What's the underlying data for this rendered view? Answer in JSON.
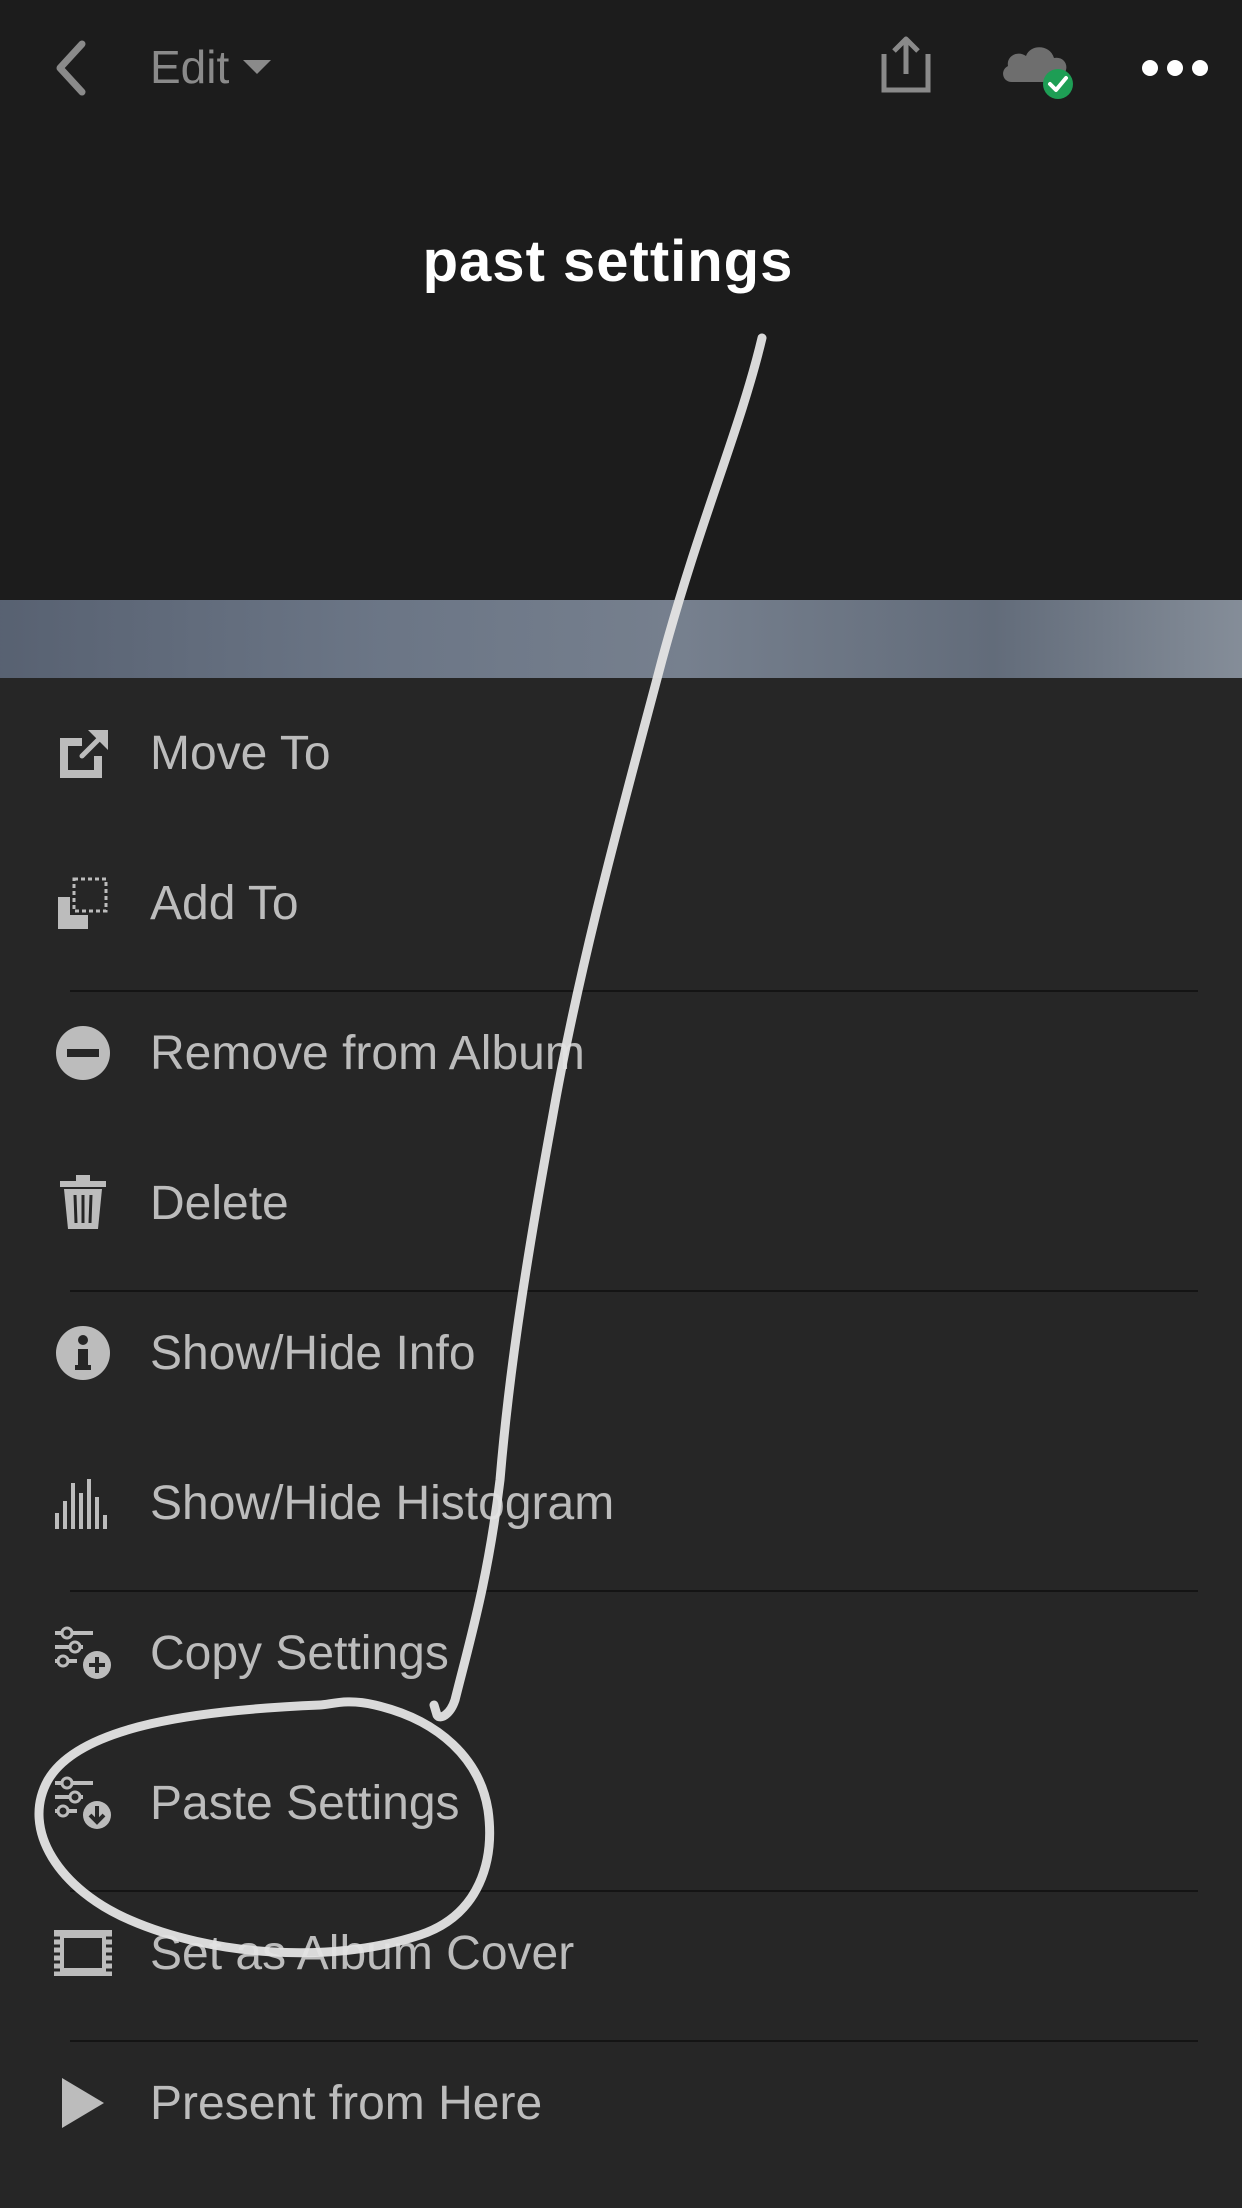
{
  "header": {
    "back_icon": "chevron-left-icon",
    "edit_label": "Edit",
    "share_icon": "share-icon",
    "cloud_icon": "cloud-synced-icon",
    "more_icon": "more-horizontal-icon",
    "sync_color": "#1e9e55"
  },
  "annotation": {
    "text": "past settings",
    "stroke_color": "#e4e4e4"
  },
  "menu": {
    "items": [
      {
        "label": "Move To",
        "icon": "move-to-icon"
      },
      {
        "label": "Add To",
        "icon": "add-to-icon"
      },
      {
        "label": "Remove from Album",
        "icon": "remove-circle-icon"
      },
      {
        "label": "Delete",
        "icon": "trash-icon"
      },
      {
        "label": "Show/Hide Info",
        "icon": "info-icon"
      },
      {
        "label": "Show/Hide Histogram",
        "icon": "histogram-icon"
      },
      {
        "label": "Copy Settings",
        "icon": "copy-settings-icon"
      },
      {
        "label": "Paste Settings",
        "icon": "paste-settings-icon"
      },
      {
        "label": "Set as Album Cover",
        "icon": "album-cover-icon"
      },
      {
        "label": "Present from Here",
        "icon": "play-icon"
      }
    ]
  }
}
